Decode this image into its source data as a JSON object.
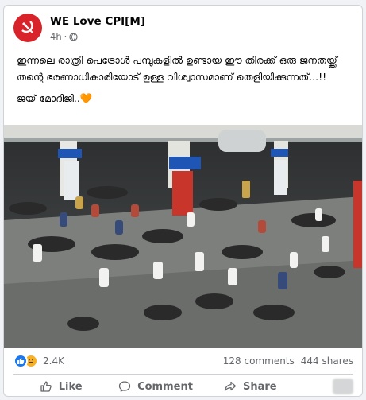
{
  "post": {
    "page_name": "WE Love CPI[M]",
    "time": "4h",
    "audience_icon": "globe-icon",
    "text_line1": "ഇന്നലെ രാത്രി പെട്രോൾ പമ്പുകളിൽ ഉണ്ടായ ഈ തിരക്ക് ഒരു ജനതയ്ക്ക് തന്റെ ഭരണാധികാരിയോട് ഉള്ള വിശ്വാസമാണ് തെളിയിക്കുന്നത്...!!",
    "text_line2": "ജയ് മോദിജി..🧡"
  },
  "stats": {
    "reaction_count": "2.4K",
    "comments": "128 comments",
    "shares": "444 shares"
  },
  "actions": {
    "like": "Like",
    "comment": "Comment",
    "share": "Share"
  },
  "colors": {
    "brand_red": "#d8232a",
    "like_blue": "#1877f2",
    "haha_yellow": "#f7b125",
    "muted_text": "#65676b"
  }
}
